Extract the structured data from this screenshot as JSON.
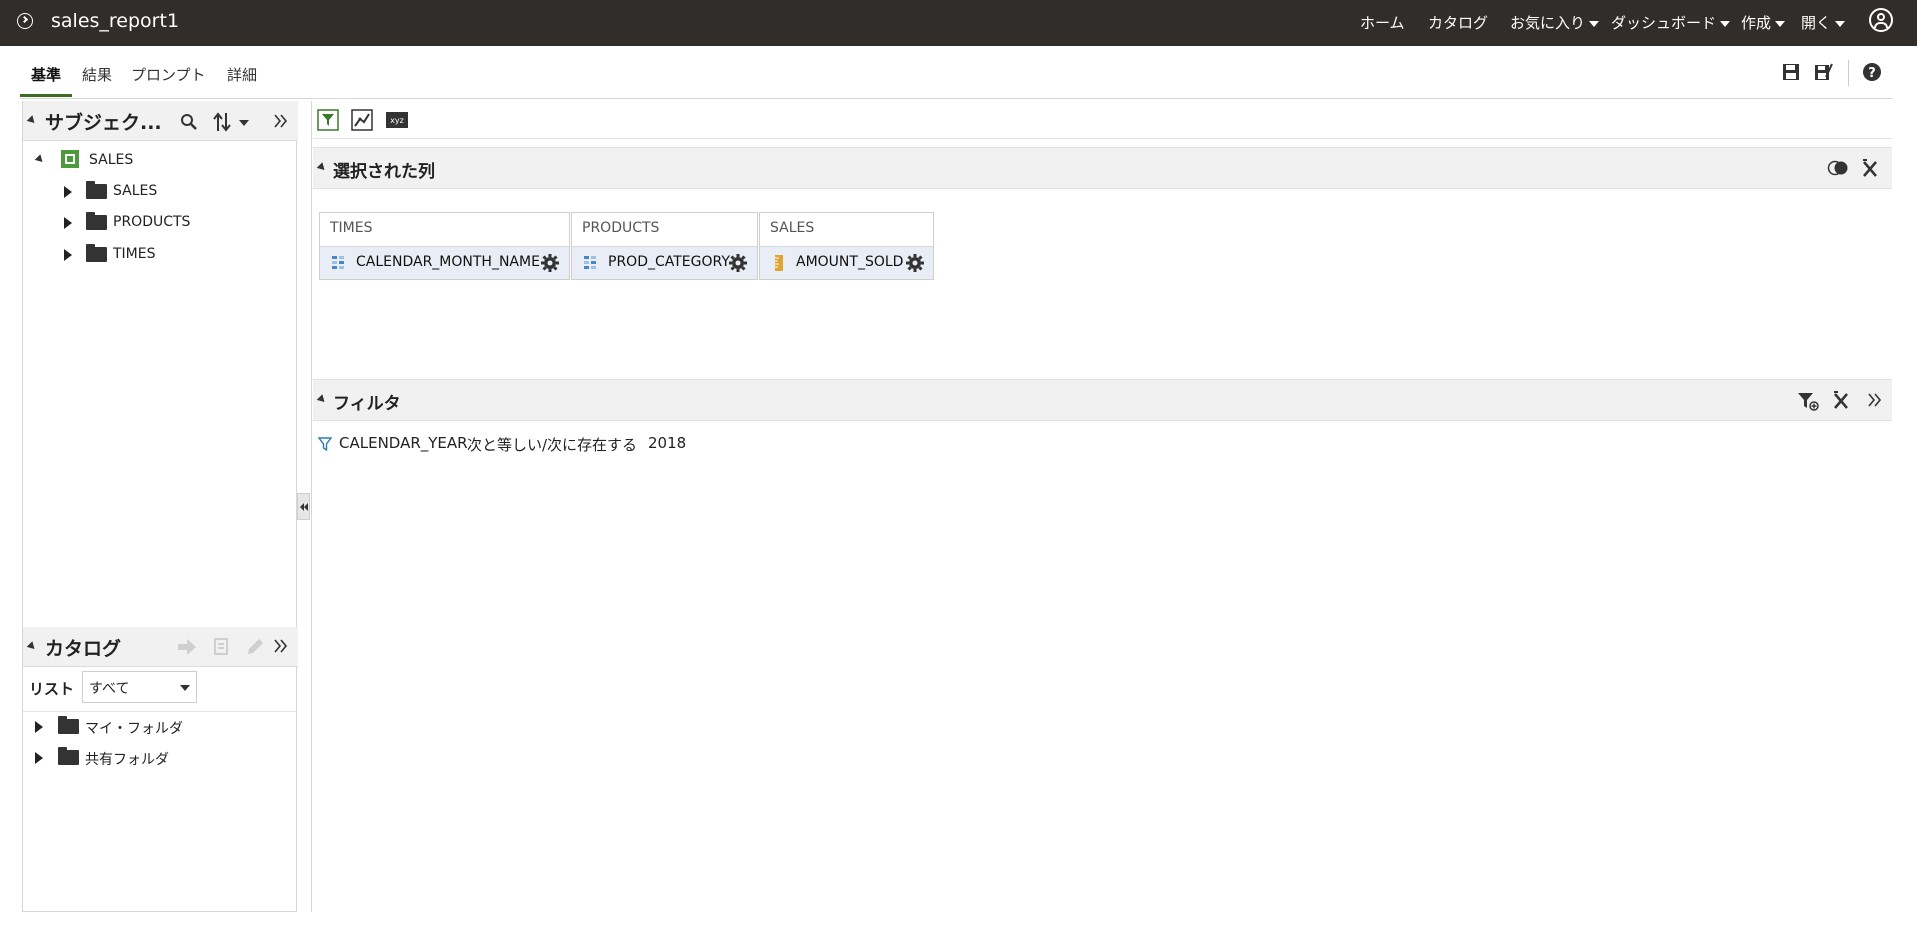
{
  "header": {
    "title": "sales_report1",
    "nav": [
      {
        "label": "ホーム",
        "dropdown": false
      },
      {
        "label": "カタログ",
        "dropdown": false
      },
      {
        "label": "お気に入り",
        "dropdown": true
      },
      {
        "label": "ダッシュボード",
        "dropdown": true
      },
      {
        "label": "作成",
        "dropdown": true
      },
      {
        "label": "開く",
        "dropdown": true
      }
    ],
    "user_icon": "user-circle-icon"
  },
  "tabs": {
    "items": [
      "基準",
      "結果",
      "プロンプト",
      "詳細"
    ],
    "active": "基準",
    "toolbar_icons": [
      "save-icon",
      "save-as-icon",
      "help-icon"
    ]
  },
  "subject_area": {
    "title": "サブジェク...",
    "root": "SALES",
    "folders": [
      "SALES",
      "PRODUCTS",
      "TIMES"
    ]
  },
  "catalog": {
    "title": "カタログ",
    "list_label": "リスト",
    "list_value": "すべて",
    "folders": [
      "マイ・フォルダ",
      "共有フォルダ"
    ]
  },
  "selected_columns": {
    "title": "選択された列",
    "groups": [
      {
        "folder": "TIMES",
        "column": "CALENDAR_MONTH_NAME",
        "kind": "attribute"
      },
      {
        "folder": "PRODUCTS",
        "column": "PROD_CATEGORY",
        "kind": "attribute"
      },
      {
        "folder": "SALES",
        "column": "AMOUNT_SOLD",
        "kind": "measure"
      }
    ]
  },
  "filters": {
    "title": "フィルタ",
    "items": [
      {
        "column": "CALENDAR_YEAR",
        "operator": "次と等しい/次に存在する",
        "value": "2018"
      }
    ]
  },
  "colors": {
    "topbar": "#312d2a",
    "accent_green": "#3b6e22",
    "attribute_blue": "#4a86c5",
    "measure_orange": "#e1a32f"
  }
}
